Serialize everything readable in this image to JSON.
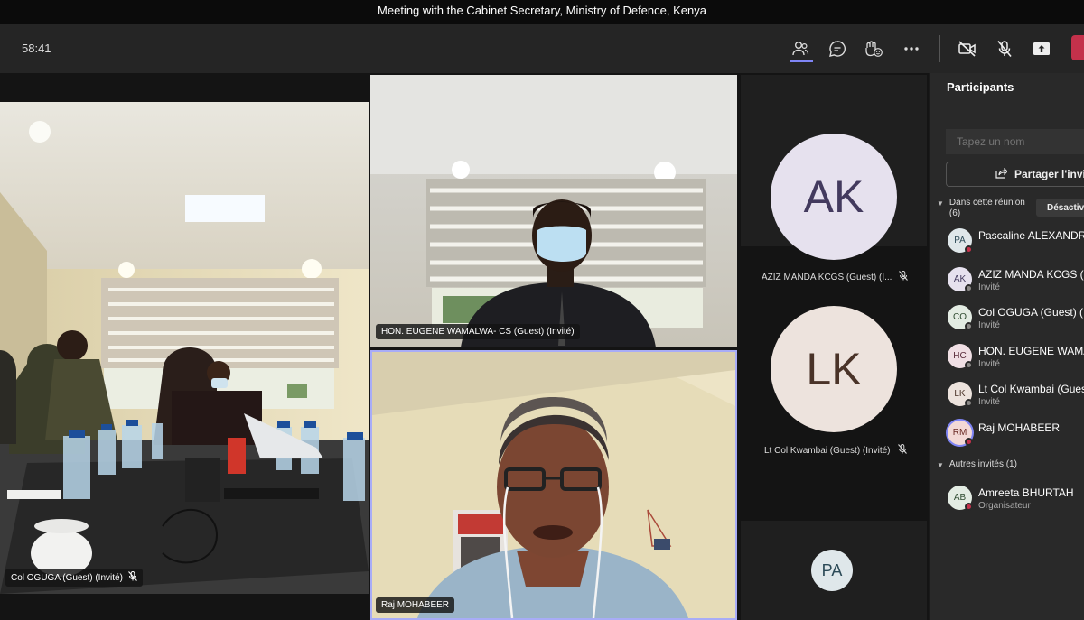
{
  "window_title": "Meeting with the Cabinet Secretary, Ministry of Defence, Kenya",
  "toolbar": {
    "timer": "58:41",
    "icons": [
      "participants-icon",
      "chat-icon",
      "reactions-icon",
      "more-icon",
      "camera-off-icon",
      "mic-off-icon",
      "share-screen-icon"
    ]
  },
  "stage": {
    "tiles": [
      {
        "name": "Col OGUGA (Guest) (Invité)",
        "muted": true
      },
      {
        "name": "HON. EUGENE WAMALWA- CS (Guest) (Invité)",
        "muted": false
      },
      {
        "name": "Raj MOHABEER",
        "muted": false,
        "active_speaker": true
      }
    ],
    "avatar_tiles": [
      {
        "initials": "AK",
        "label": "AZIZ MANDA KCGS (Guest) (I...",
        "bg": "#e6e1ee",
        "fg": "#433a5e"
      },
      {
        "initials": "LK",
        "label": "Lt Col Kwambai (Guest) (Invité)",
        "bg": "#ede3dd",
        "fg": "#4a3328"
      },
      {
        "initials": "PA",
        "label": "",
        "bg": "#dfe7ea",
        "fg": "#2c4a57"
      }
    ]
  },
  "panel": {
    "title": "Participants",
    "search_placeholder": "Tapez un nom",
    "share_invite_label": "Partager l'invit",
    "in_meeting_label": "Dans cette réunion",
    "in_meeting_count": "(6)",
    "mute_all_label": "Désactiv",
    "participants": [
      {
        "initials": "PA",
        "name": "Pascaline ALEXANDRE",
        "subtitle": "",
        "bg": "#dfe7ea",
        "fg": "#2c4a57",
        "status": "#c4314b"
      },
      {
        "initials": "AK",
        "name": "AZIZ MANDA KCGS (G",
        "subtitle": "Invité",
        "bg": "#e6e1ee",
        "fg": "#433a5e",
        "status": "#8a8886"
      },
      {
        "initials": "CO",
        "name": "Col OGUGA (Guest) (In",
        "subtitle": "Invité",
        "bg": "#e3ece3",
        "fg": "#2d4a2f",
        "status": "#8a8886"
      },
      {
        "initials": "HC",
        "name": "HON. EUGENE WAMAL",
        "subtitle": "Invité",
        "bg": "#f0dfe4",
        "fg": "#5a2b3a",
        "status": "#8a8886"
      },
      {
        "initials": "LK",
        "name": "Lt Col Kwambai (Guest",
        "subtitle": "Invité",
        "bg": "#ede3dd",
        "fg": "#4a3328",
        "status": "#8a8886"
      },
      {
        "initials": "RM",
        "name": "Raj MOHABEER",
        "subtitle": "",
        "bg": "#f3d9d6",
        "fg": "#6b2b25",
        "status": "#c4314b"
      }
    ],
    "other_label": "Autres invités (1)",
    "others": [
      {
        "initials": "AB",
        "name": "Amreeta BHURTAH",
        "subtitle": "Organisateur",
        "bg": "#e3ece3",
        "fg": "#2d4a2f",
        "status": "#c4314b"
      }
    ]
  },
  "colors": {
    "accent": "#7f85f5",
    "leave": "#c4314b",
    "muted_status": "#c4314b"
  }
}
